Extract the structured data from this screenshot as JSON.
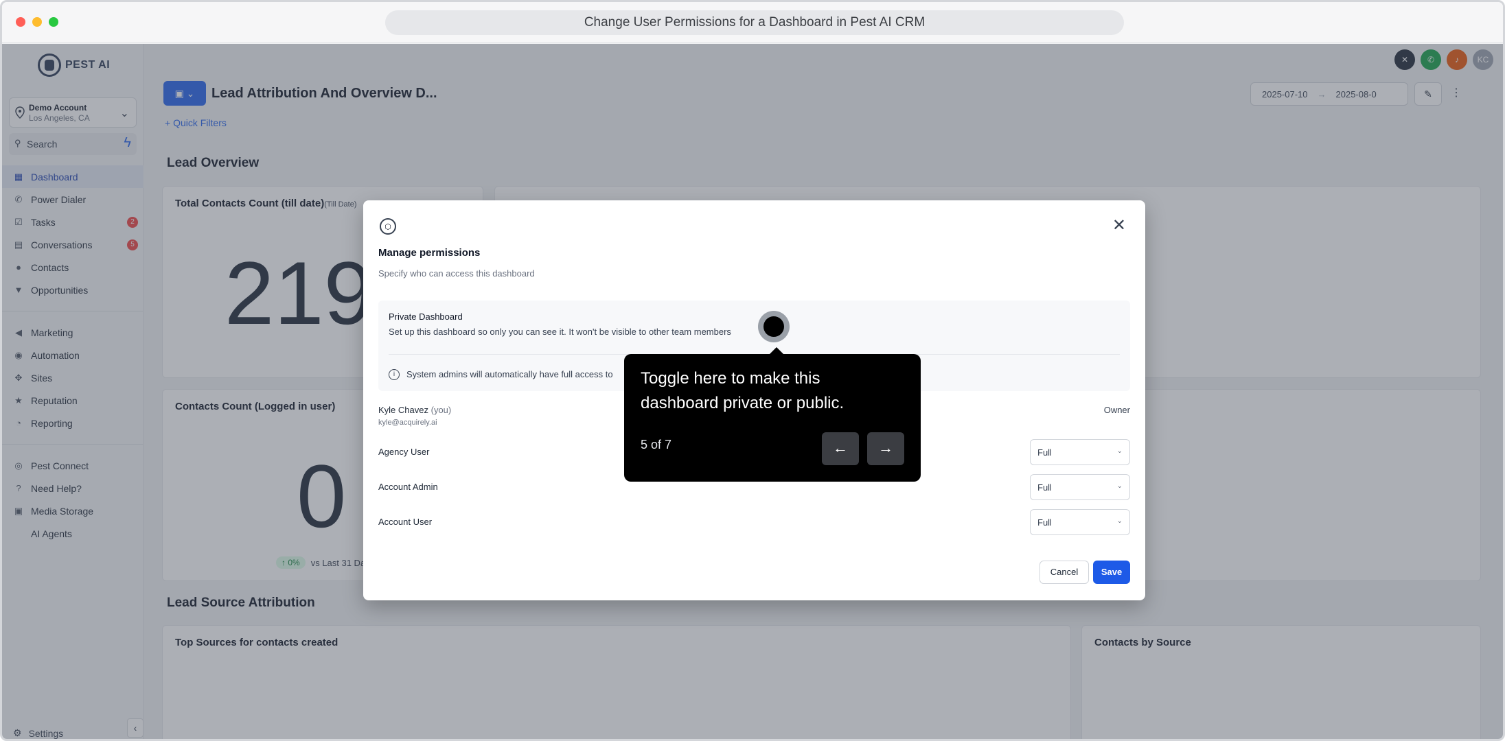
{
  "browser": {
    "title": "Change User Permissions for a Dashboard in Pest AI CRM"
  },
  "sidebar": {
    "logo_text": "PEST AI",
    "account": {
      "name": "Demo Account",
      "location": "Los Angeles, CA"
    },
    "search_placeholder": "Search",
    "items": [
      {
        "label": "Dashboard",
        "icon": "dashboard-icon",
        "active": true
      },
      {
        "label": "Power Dialer",
        "icon": "phone-icon"
      },
      {
        "label": "Tasks",
        "icon": "tasks-icon",
        "badge": "2"
      },
      {
        "label": "Conversations",
        "icon": "chat-icon",
        "badge": "5"
      },
      {
        "label": "Contacts",
        "icon": "user-icon"
      },
      {
        "label": "Opportunities",
        "icon": "filter-icon"
      }
    ],
    "items2": [
      {
        "label": "Marketing",
        "icon": "megaphone-icon"
      },
      {
        "label": "Automation",
        "icon": "automation-icon"
      },
      {
        "label": "Sites",
        "icon": "sites-icon"
      },
      {
        "label": "Reputation",
        "icon": "star-icon"
      },
      {
        "label": "Reporting",
        "icon": "chart-icon"
      }
    ],
    "items3": [
      {
        "label": "Pest Connect",
        "icon": "connect-icon"
      },
      {
        "label": "Need Help?",
        "icon": "help-icon"
      },
      {
        "label": "Media Storage",
        "icon": "media-icon"
      },
      {
        "label": "AI Agents"
      }
    ],
    "settings_label": "Settings"
  },
  "header": {
    "dashboard_title": "Lead Attribution And Overview D...",
    "date_from": "2025-07-10",
    "date_to": "2025-08-0",
    "quick_filters": "Quick Filters",
    "avatar_initials": "KC"
  },
  "content": {
    "lead_overview": "Lead Overview",
    "card1_title": "Total Contacts Count (till date)",
    "card1_suffix": "(Till Date)",
    "card1_value": "219",
    "card2_title": "Contacts Count (Logged in user)",
    "card2_value": "0",
    "card2_trend": "0%",
    "card2_trend_note": "vs Last 31 Da",
    "lead_source": "Lead Source Attribution",
    "card3_title": "Top Sources for contacts created",
    "card4_title": "Contacts by Source"
  },
  "modal": {
    "title": "Manage permissions",
    "subtitle": "Specify who can access this dashboard",
    "private_title": "Private Dashboard",
    "private_desc": "Set up this dashboard so only you can see it. It won't be visible to other team members",
    "info_text": "System admins will automatically have full access to",
    "owner": {
      "name": "Kyle Chavez",
      "you": "(you)",
      "email": "kyle@acquirely.ai",
      "role": "Owner"
    },
    "rows": [
      {
        "name": "Agency User",
        "value": "Full"
      },
      {
        "name": "Account Admin",
        "value": "Full"
      },
      {
        "name": "Account User",
        "value": "Full"
      }
    ],
    "cancel": "Cancel",
    "save": "Save"
  },
  "tooltip": {
    "text": "Toggle here to make this dashboard private or public.",
    "step": "5 of 7"
  },
  "colors": {
    "accent": "#2563eb",
    "save": "#1d5ae7",
    "badge": "#ef4444"
  }
}
